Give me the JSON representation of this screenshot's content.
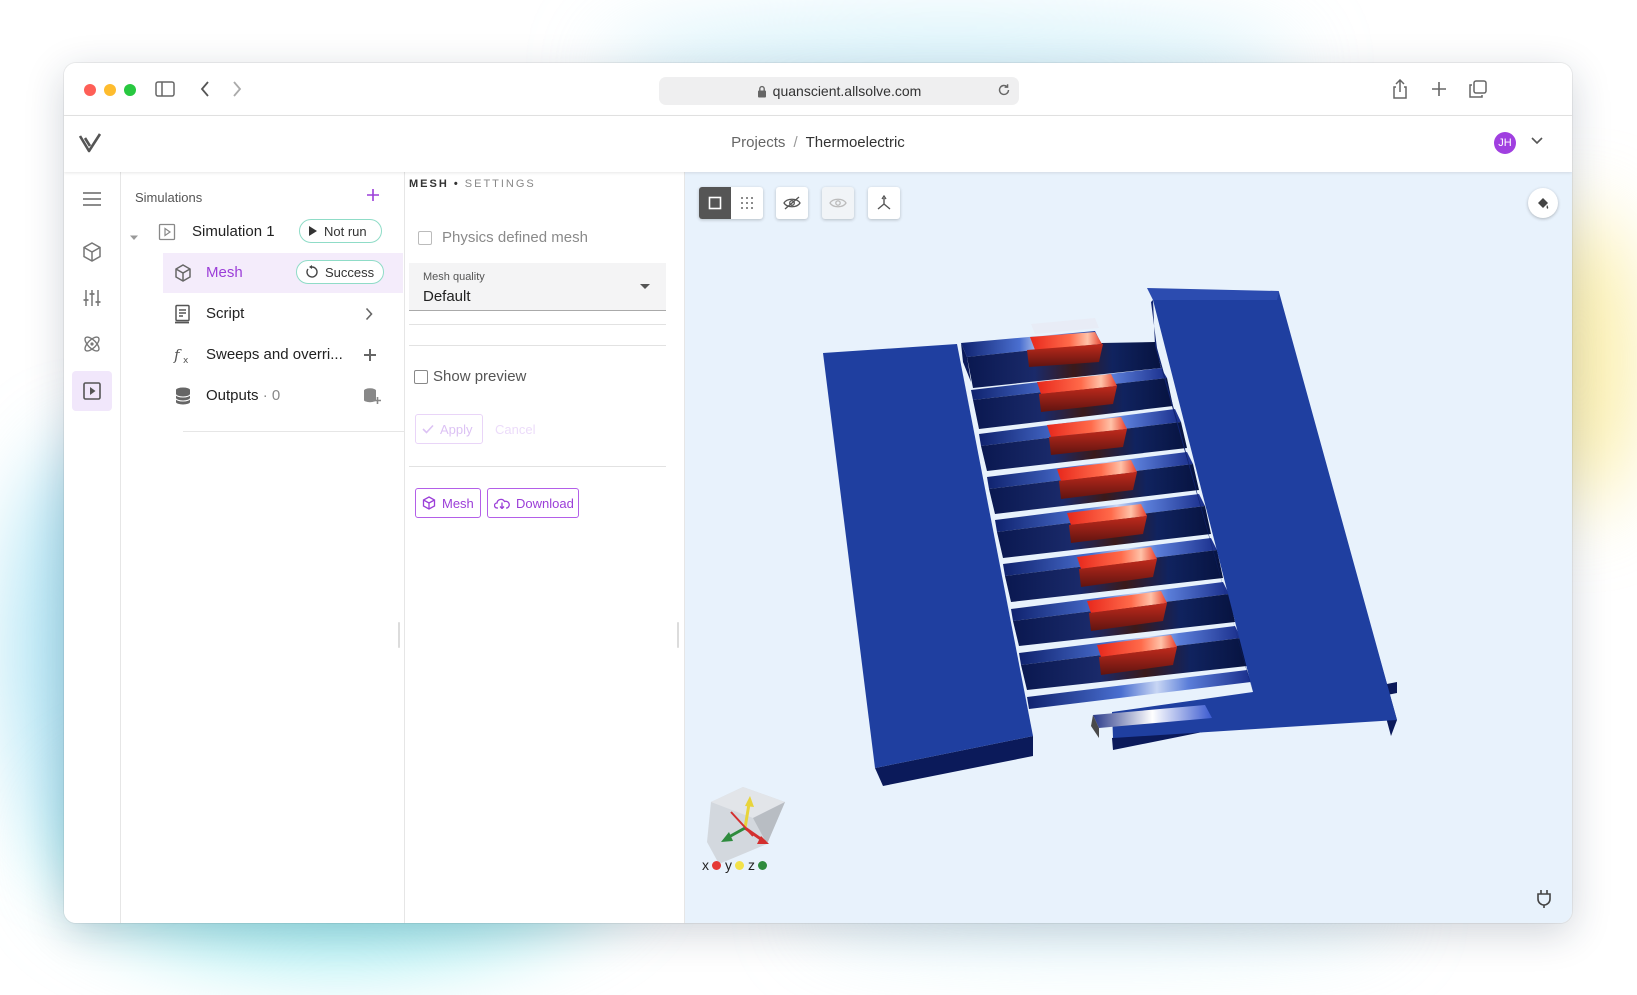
{
  "browser": {
    "url": "quanscient.allsolve.com"
  },
  "header": {
    "breadcrumb_root": "Projects",
    "breadcrumb_separator": "/",
    "breadcrumb_current": "Thermoelectric",
    "avatar_initials": "JH"
  },
  "rail": {
    "items": [
      "menu-icon",
      "geometry-icon",
      "settings-sliders-icon",
      "physics-atom-icon",
      "simulation-play-icon"
    ],
    "active": "simulation-play-icon"
  },
  "tree": {
    "title": "Simulations",
    "simulation": {
      "label": "Simulation 1",
      "status": "Not run"
    },
    "mesh": {
      "label": "Mesh",
      "status": "Success"
    },
    "script": {
      "label": "Script"
    },
    "sweeps": {
      "label": "Sweeps and overri..."
    },
    "outputs": {
      "label": "Outputs",
      "separator": "·",
      "count": "0"
    }
  },
  "settings": {
    "title": "MESH",
    "title_separator": "•",
    "subtitle": "SETTINGS",
    "physics_defined_mesh_label": "Physics defined mesh",
    "physics_defined_mesh_checked": false,
    "mesh_quality_label": "Mesh quality",
    "mesh_quality_value": "Default",
    "show_preview_label": "Show preview",
    "show_preview_checked": false,
    "apply_label": "Apply",
    "cancel_label": "Cancel",
    "mesh_button_label": "Mesh",
    "download_button_label": "Download"
  },
  "viewport": {
    "toolbar": [
      "solid-view-icon",
      "mesh-points-icon",
      "hide-icon",
      "show-icon",
      "axes-icon"
    ],
    "active_tool": "solid-view-icon",
    "axis_labels": [
      "x",
      "y",
      "z"
    ],
    "axis_colors": {
      "x": "#e53935",
      "y": "#f3e24a",
      "z": "#2e8b3d"
    },
    "model_colors": {
      "body": "#1f3fa0",
      "hot": "#f23a2b",
      "cold": "#0a1a5a"
    }
  },
  "colors": {
    "accent": "#9b3ed8",
    "success_border": "#8fdcc7",
    "viewport_bg": "#e8f2fc"
  }
}
